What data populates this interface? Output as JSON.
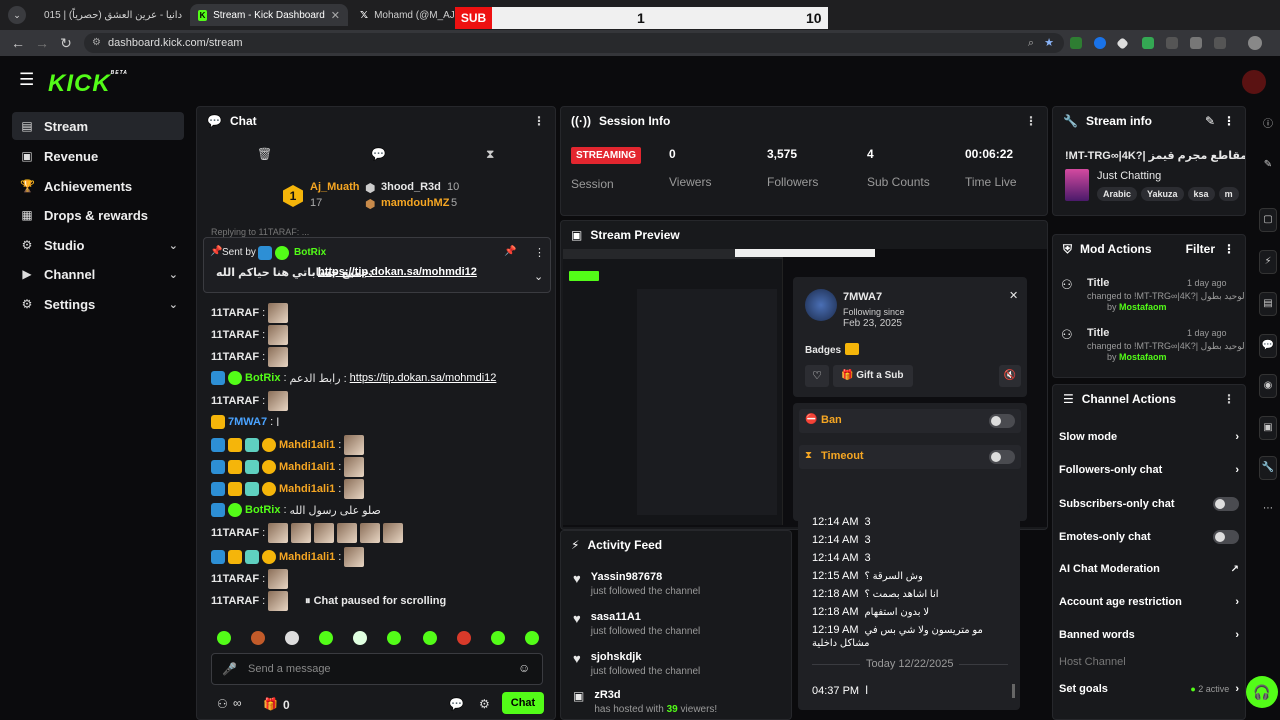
{
  "browser": {
    "tabs": [
      {
        "title": "دانيا - عرين العشق (حصرياً) | 015"
      },
      {
        "title": "Stream - Kick Dashboard"
      },
      {
        "title": "Mohamd (@M_AJJ1) / X"
      }
    ],
    "overlay": {
      "label": "SUB",
      "value_a": "1",
      "value_b": "10"
    },
    "url": "dashboard.kick.com/stream"
  },
  "app": {
    "logo": "KICK",
    "logo_beta": "BETA"
  },
  "sidebar": {
    "items": [
      {
        "label": "Stream",
        "icon": "stream-icon"
      },
      {
        "label": "Revenue",
        "icon": "revenue-icon"
      },
      {
        "label": "Achievements",
        "icon": "trophy-icon"
      },
      {
        "label": "Drops & rewards",
        "icon": "drops-icon"
      },
      {
        "label": "Studio",
        "icon": "studio-icon"
      },
      {
        "label": "Channel",
        "icon": "channel-icon"
      },
      {
        "label": "Settings",
        "icon": "settings-icon"
      }
    ]
  },
  "chat": {
    "title": "Chat",
    "leaderboard": [
      {
        "name": "Aj_Muath",
        "count": "17"
      },
      {
        "name": "3hood_R3d",
        "count": "10"
      },
      {
        "name": "mamdouhMZ",
        "count": "5"
      }
    ],
    "replying": "Replying to 11TARAF: ...",
    "pinned": {
      "sent_by_label": "Sent by",
      "sender": "BotRix",
      "text": "جميع حساباتي هنا حياكم الله:",
      "link": "https://tip.dokan.sa/mohmdi12"
    },
    "messages": [
      {
        "user": "11TARAF",
        "text": ""
      },
      {
        "user": "11TARAF",
        "text": ""
      },
      {
        "user": "11TARAF",
        "text": ""
      },
      {
        "user": "BotRix",
        "text": "رابط الدعم :",
        "link": "https://tip.dokan.sa/mohmdi12"
      },
      {
        "user": "11TARAF",
        "text": ""
      },
      {
        "user": "7MWA7",
        "text": "ا"
      },
      {
        "user": "Mahdi1ali1",
        "text": ""
      },
      {
        "user": "Mahdi1ali1",
        "text": ""
      },
      {
        "user": "Mahdi1ali1",
        "text": ""
      },
      {
        "user": "BotRix",
        "text": "صلو على رسول الله"
      },
      {
        "user": "11TARAF",
        "text": ""
      },
      {
        "user": "Mahdi1ali1",
        "text": ""
      },
      {
        "user": "11TARAF",
        "text": ""
      },
      {
        "user": "11TARAF",
        "text": ""
      }
    ],
    "paused": "Chat paused for scrolling",
    "input_placeholder": "Send a message",
    "footer_count": "0",
    "send_label": "Chat"
  },
  "session": {
    "title": "Session Info",
    "status": "STREAMING",
    "session_label": "Session",
    "stats": [
      {
        "value": "0",
        "label": "Viewers"
      },
      {
        "value": "3,575",
        "label": "Followers"
      },
      {
        "value": "4",
        "label": "Sub Counts"
      },
      {
        "value": "00:06:22",
        "label": "Time Live"
      }
    ]
  },
  "preview": {
    "title": "Stream Preview",
    "user_card": {
      "name": "7MWA7",
      "following_since_label": "Following since",
      "following_since": "Feb 23, 2025",
      "badges_label": "Badges",
      "gift_label": "Gift a Sub",
      "ban_label": "Ban",
      "timeout_label": "Timeout",
      "log": [
        {
          "time": "12:14 AM",
          "text": "3"
        },
        {
          "time": "12:14 AM",
          "text": "3"
        },
        {
          "time": "12:14 AM",
          "text": "3"
        },
        {
          "time": "12:15 AM",
          "text": "وش السرقة ؟"
        },
        {
          "time": "12:18 AM",
          "text": "انا اشاهد بصمت ؟"
        },
        {
          "time": "12:18 AM",
          "text": "لا بدون استفهام"
        },
        {
          "time": "12:19 AM",
          "text": "مو متريسون ولا شي بس في مشاكل داخلية"
        }
      ],
      "date_divider": "Today 12/22/2025",
      "last": {
        "time": "04:37 PM",
        "text": "ا"
      }
    }
  },
  "activity": {
    "title": "Activity Feed",
    "items": [
      {
        "name": "Yassin987678",
        "sub": "just followed the channel"
      },
      {
        "name": "sasa11A1",
        "sub": "just followed the channel"
      },
      {
        "name": "sjohskdjk",
        "sub": "just followed the channel"
      },
      {
        "name": "zR3d",
        "sub_a": "has hosted with",
        "count": "39",
        "sub_b": "viewers!"
      }
    ]
  },
  "stream_info": {
    "title": "Stream info",
    "stream_title": "!MT-TRG∞|4K?| مقاطع مجرم قيمز",
    "category": "Just Chatting",
    "tags": [
      "Arabic",
      "Yakuza",
      "ksa",
      "m"
    ]
  },
  "mod_actions": {
    "title": "Mod Actions",
    "filter": "Filter",
    "items": [
      {
        "label": "Title",
        "time": "1 day ago",
        "changed": "changed to !MT-TRG∞|4K?| الوحيد بطول",
        "by": "by",
        "mod": "Mostafaom"
      },
      {
        "label": "Title",
        "time": "1 day ago",
        "changed": "changed to !MT-TRG∞|4K?| الوحيد بطول",
        "by": "by",
        "mod": "Mostafaom"
      }
    ]
  },
  "channel_actions": {
    "title": "Channel Actions",
    "rows": [
      {
        "label": "Slow mode"
      },
      {
        "label": "Followers-only chat"
      },
      {
        "label": "Subscribers-only chat"
      },
      {
        "label": "Emotes-only chat"
      },
      {
        "label": "AI Chat Moderation"
      },
      {
        "label": "Account age restriction"
      },
      {
        "label": "Banned words"
      },
      {
        "label": "Host Channel"
      },
      {
        "label": "Set goals",
        "status": "2 active"
      }
    ]
  },
  "colors": {
    "accent": "#53fc18",
    "streaming": "#e3262f",
    "username_orange": "#f5a623",
    "username_blue": "#4aa3ff"
  }
}
